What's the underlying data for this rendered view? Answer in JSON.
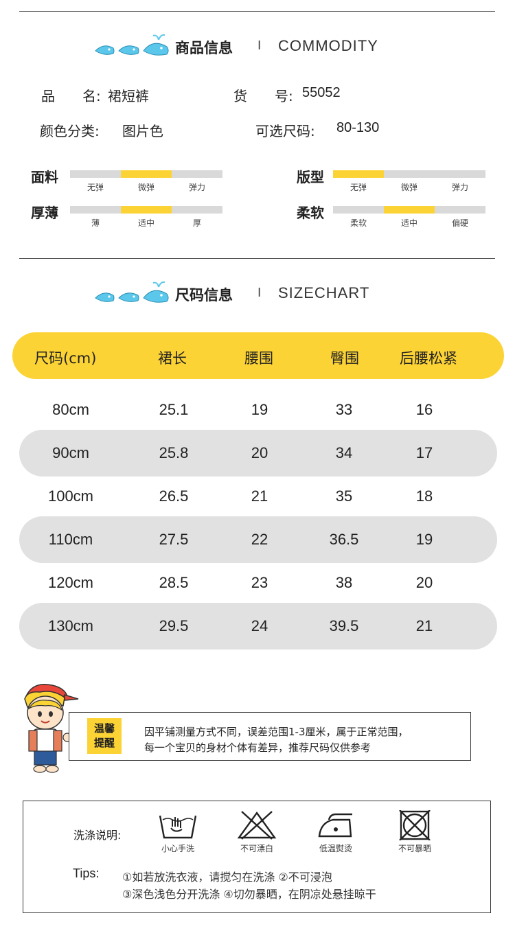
{
  "section1": {
    "title_cn": "商品信息",
    "separator": "I",
    "title_en": "COMMODITY"
  },
  "product": {
    "name_label": "品　　名:",
    "name_value": "裙短裤",
    "item_no_label": "货　　号:",
    "item_no_value": "55052",
    "color_label": "颜色分类:",
    "color_value": "图片色",
    "size_label": "可选尺码:",
    "size_value": "80-130"
  },
  "attributes": [
    {
      "name": "面料",
      "ticks": [
        "无弹",
        "微弹",
        "弹力"
      ],
      "selected_index": 1
    },
    {
      "name": "版型",
      "ticks": [
        "无弹",
        "微弹",
        "弹力"
      ],
      "selected_index": 0
    },
    {
      "name": "厚薄",
      "ticks": [
        "薄",
        "适中",
        "厚"
      ],
      "selected_index": 1
    },
    {
      "name": "柔软",
      "ticks": [
        "柔软",
        "适中",
        "偏硬"
      ],
      "selected_index": 1
    }
  ],
  "section2": {
    "title_cn": "尺码信息",
    "separator": "I",
    "title_en": "SIZECHART"
  },
  "size_table": {
    "headers": [
      "尺码(cm)",
      "裙长",
      "腰围",
      "臀围",
      "后腰松紧"
    ],
    "rows": [
      [
        "80cm",
        "25.1",
        "19",
        "33",
        "16"
      ],
      [
        "90cm",
        "25.8",
        "20",
        "34",
        "17"
      ],
      [
        "100cm",
        "26.5",
        "21",
        "35",
        "18"
      ],
      [
        "110cm",
        "27.5",
        "22",
        "36.5",
        "19"
      ],
      [
        "120cm",
        "28.5",
        "23",
        "38",
        "20"
      ],
      [
        "130cm",
        "29.5",
        "24",
        "39.5",
        "21"
      ]
    ]
  },
  "notice": {
    "tag_line1": "温馨",
    "tag_line2": "提醒",
    "line1": "因平铺测量方式不同，误差范围1-3厘米，属于正常范围，",
    "line2": "每一个宝贝的身材个体有差异，推荐尺码仅供参考"
  },
  "wash": {
    "title": "洗涤说明:",
    "icons": [
      {
        "icon": "hand-wash-icon",
        "label": "小心手洗"
      },
      {
        "icon": "no-bleach-icon",
        "label": "不可漂白"
      },
      {
        "icon": "low-iron-icon",
        "label": "低温熨烫"
      },
      {
        "icon": "no-sun-icon",
        "label": "不可暴晒"
      }
    ],
    "tips_label": "Tips:",
    "tips_line1": "①如若放洗衣液，请搅匀在洗涤 ②不可浸泡",
    "tips_line2": "③深色浅色分开洗涤 ④切勿暴晒，在阴凉处悬挂晾干"
  },
  "colors": {
    "accent": "#fcd335",
    "bar_off": "#d9d9d9",
    "row_alt": "#e1e1e1",
    "whale": "#5bc7ea"
  }
}
